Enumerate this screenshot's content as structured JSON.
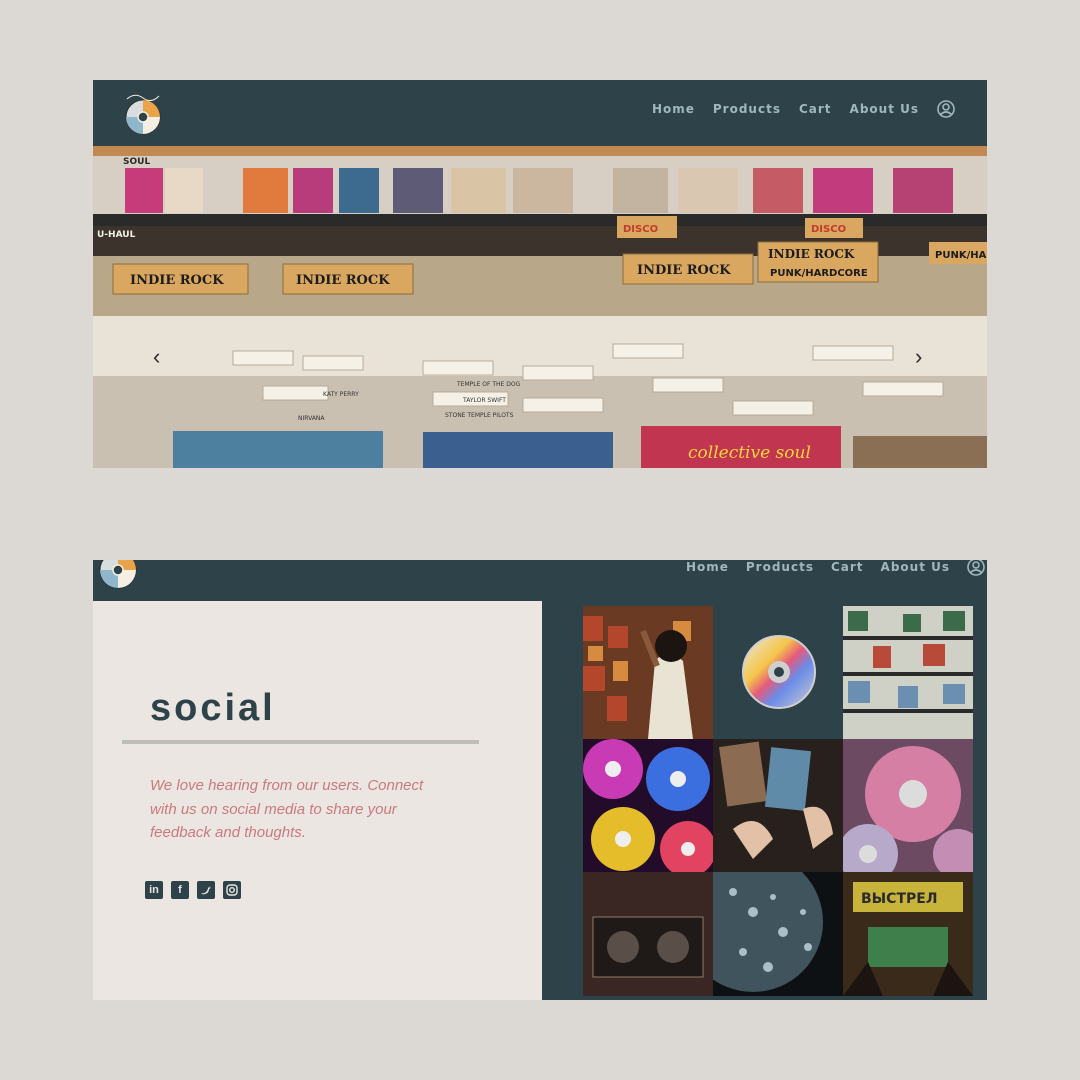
{
  "nav": {
    "links": [
      "Home",
      "Products",
      "Cart",
      "About Us"
    ],
    "user_icon": "user-circle-icon",
    "logo_icon": "cd-logo-icon"
  },
  "hero": {
    "image": "record-store-bins-photo",
    "signs": [
      "SOUL",
      "INDIE ROCK",
      "INDIE ROCK",
      "INDIE ROCK",
      "INDIE ROCK",
      "PUNK/HARDCORE",
      "PUNK/HAR",
      "DISCO",
      "DISCO",
      "U-HAUL",
      "collective soul"
    ],
    "dividers": [
      "KATY PERRY",
      "NIRVANA",
      "TEMPLE OF THE DOG",
      "TAYLOR SWIFT",
      "STONE TEMPLE PILOTS"
    ],
    "next_arrow": "chevron-right-icon",
    "prev_arrow": "chevron-left-icon"
  },
  "social": {
    "title": "social",
    "blurb": "We love hearing from our users. Connect with us on social media to share your feedback and thoughts.",
    "icons": [
      "linkedin-icon",
      "facebook-icon",
      "twitter-icon",
      "instagram-icon"
    ]
  },
  "gallery": {
    "tiles": [
      "person-browsing-records",
      "cd-icon-tile",
      "record-shelves",
      "rainbow-cds",
      "hand-flipping-records",
      "pink-cds",
      "vintage-tape-deck",
      "water-droplets-cd",
      "arcade-sign"
    ],
    "sign_text": "ВЫСТРЕЛ"
  },
  "colors": {
    "dark_teal": "#2e4349",
    "cream": "#ebe6e2",
    "accent_pink": "#c97a7f",
    "nav_text": "#9fb7bf"
  }
}
